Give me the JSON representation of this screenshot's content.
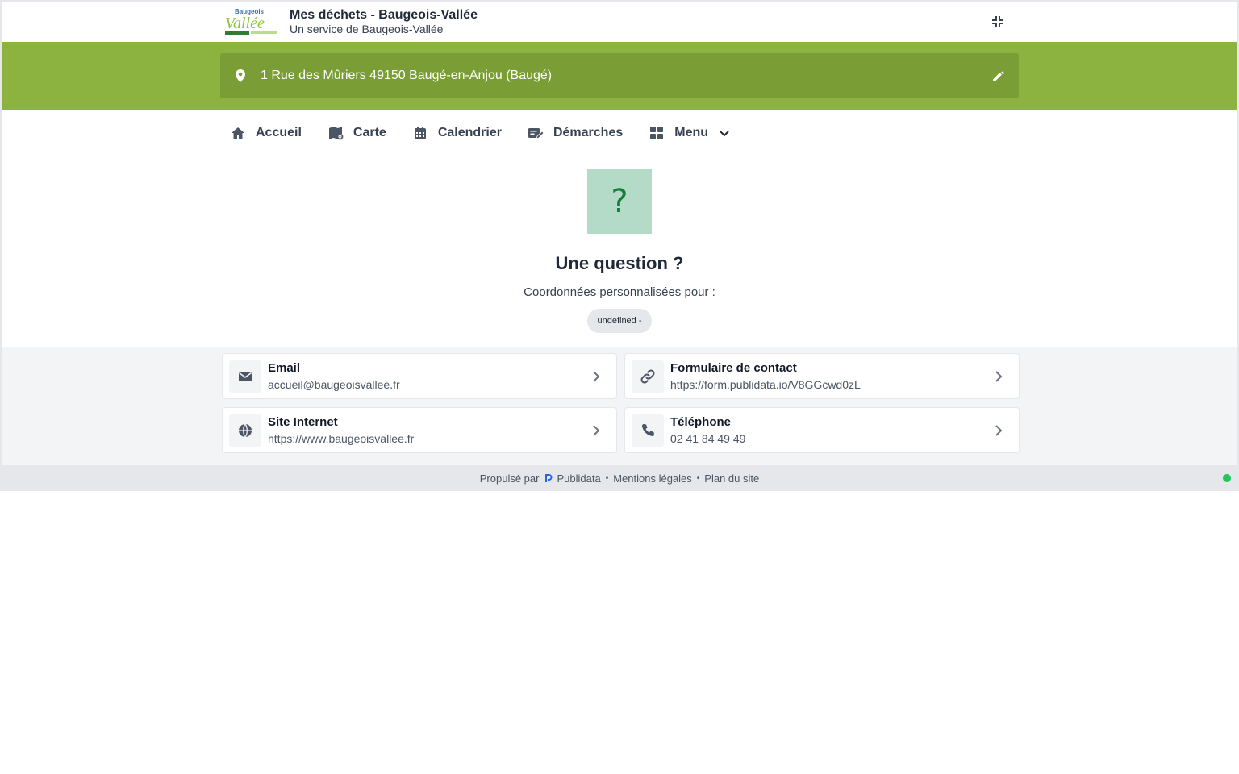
{
  "header": {
    "logo_text": "Baugeois Vallée",
    "title": "Mes déchets - Baugeois-Vallée",
    "subtitle": "Un service de Baugeois-Vallée",
    "collapse_icon": "compress-icon"
  },
  "address": {
    "value": "1 Rue des Mûriers 49150 Baugé-en-Anjou (Baugé)",
    "icon": "map-pin-icon",
    "edit_icon": "pencil-icon"
  },
  "nav": {
    "items": [
      {
        "label": "Accueil",
        "icon": "home-icon"
      },
      {
        "label": "Carte",
        "icon": "map-icon"
      },
      {
        "label": "Calendrier",
        "icon": "calendar-icon"
      },
      {
        "label": "Démarches",
        "icon": "form-edit-icon"
      },
      {
        "label": "Menu",
        "icon": "grid-icon"
      }
    ]
  },
  "question": {
    "symbol": "?",
    "title": "Une question ?",
    "subtitle": "Coordonnées personnalisées pour :",
    "badge": "undefined -"
  },
  "contacts": [
    {
      "title": "Email",
      "value": "accueil@baugeoisvallee.fr",
      "icon": "envelope-icon"
    },
    {
      "title": "Formulaire de contact",
      "value": "https://form.publidata.io/V8GGcwd0zL",
      "icon": "link-icon"
    },
    {
      "title": "Site Internet",
      "value": "https://www.baugeoisvallee.fr",
      "icon": "globe-icon"
    },
    {
      "title": "Téléphone",
      "value": "02 41 84 49 49",
      "icon": "phone-icon"
    }
  ],
  "footer": {
    "powered_by": "Propulsé par",
    "brand": "Publidata",
    "legal": "Mentions légales",
    "sitemap": "Plan du site",
    "separator": "•"
  },
  "colors": {
    "brand_green": "#8cb33f",
    "address_box": "#7a9e35",
    "question_bg": "#b3dbc7",
    "question_mark": "#15803d",
    "status_online": "#22c55e"
  }
}
